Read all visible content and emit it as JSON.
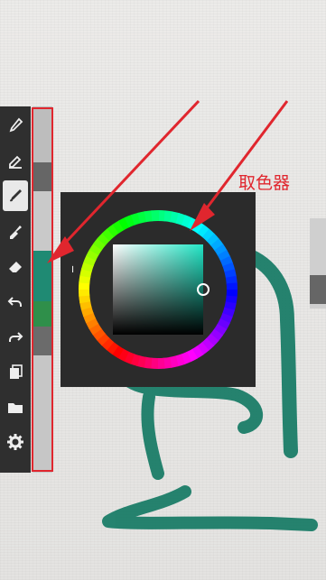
{
  "annotation": {
    "label": "取色器",
    "color": "#e0262e"
  },
  "toolbar": {
    "tools": [
      {
        "icon": "eyedropper-icon",
        "active": false
      },
      {
        "icon": "pencil-underline-icon",
        "active": false
      },
      {
        "icon": "brush-icon",
        "active": true
      },
      {
        "icon": "smudge-icon",
        "active": false
      },
      {
        "icon": "eraser-icon",
        "active": false
      },
      {
        "icon": "undo-icon",
        "active": false
      },
      {
        "icon": "redo-icon",
        "active": false
      },
      {
        "icon": "layers-icon",
        "active": false
      },
      {
        "icon": "folder-icon",
        "active": false
      },
      {
        "icon": "settings-gear-icon",
        "active": false
      }
    ]
  },
  "swatches": [
    {
      "color": "#bdbdbd"
    },
    {
      "color": "#666666"
    },
    {
      "color": "#c9c9c9"
    },
    {
      "color": "#1f8a73"
    },
    {
      "color": "#2f8f4a"
    },
    {
      "color": "#6b6b6b"
    },
    {
      "color": "#c6c6c6"
    }
  ],
  "color_picker": {
    "selected_color": "#22e6c6",
    "stroke_color": "#1b7d68"
  }
}
